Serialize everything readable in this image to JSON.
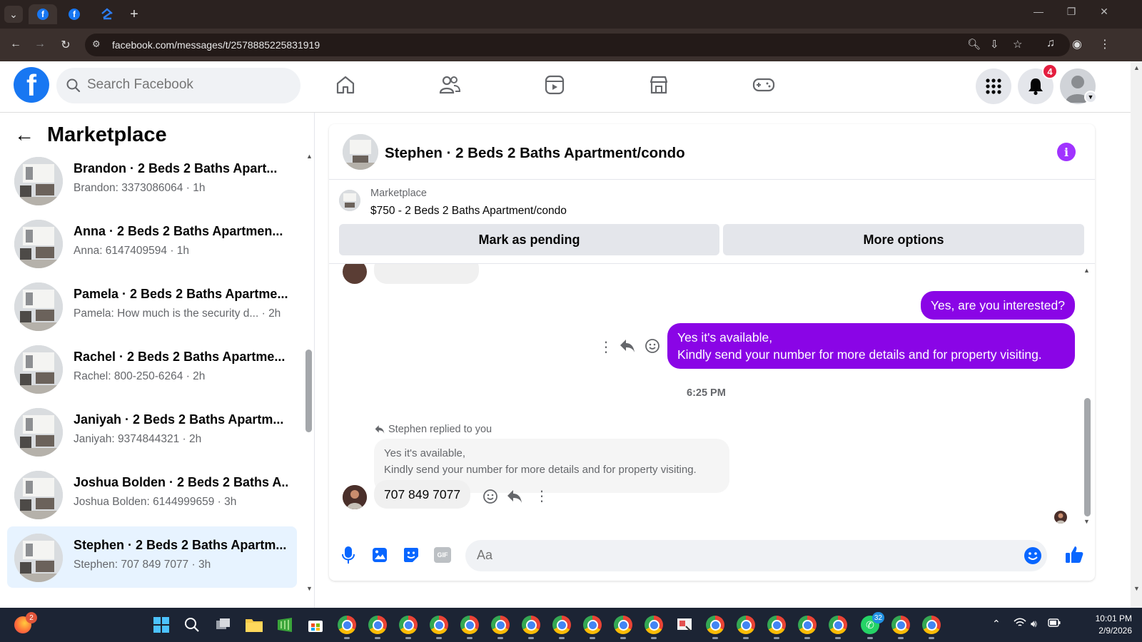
{
  "browser": {
    "url": "facebook.com/messages/t/2578885225831919",
    "new_tab": "+"
  },
  "facebook": {
    "logo_letter": "f",
    "search_placeholder": "Search Facebook",
    "notifications_count": "4"
  },
  "sidebar": {
    "title": "Marketplace",
    "conversations": [
      {
        "title": "Brandon · 2 Beds 2 Baths Apart...",
        "preview": "Brandon: 3373086064 · 1h",
        "selected": false
      },
      {
        "title": "Anna · 2 Beds 2 Baths Apartmen...",
        "preview": "Anna: 6147409594 · 1h",
        "selected": false
      },
      {
        "title": "Pamela · 2 Beds 2 Baths Apartme...",
        "preview": "Pamela: How much is the security d... · 2h",
        "selected": false
      },
      {
        "title": "Rachel · 2 Beds 2 Baths Apartme...",
        "preview": "Rachel: 800-250-6264 · 2h",
        "selected": false
      },
      {
        "title": "Janiyah · 2 Beds 2 Baths Apartm...",
        "preview": "Janiyah: 9374844321 · 2h",
        "selected": false
      },
      {
        "title": "Joshua Bolden · 2 Beds 2 Baths A...",
        "preview": "Joshua Bolden: 6144999659 · 3h",
        "selected": false
      },
      {
        "title": "Stephen · 2 Beds 2 Baths Apartm...",
        "preview": "Stephen: 707 849 7077 · 3h",
        "selected": true
      }
    ]
  },
  "chat": {
    "title": "Stephen · 2 Beds 2 Baths Apartment/condo",
    "marketplace_label": "Marketplace",
    "listing": "$750 - 2 Beds 2 Baths Apartment/condo",
    "mark_pending": "Mark as pending",
    "more_options": "More options",
    "messages": {
      "out1": "Yes, are you interested?",
      "out2_line1": "Yes it's available,",
      "out2_line2": "Kindly send your number for more details and for property visiting.",
      "timestamp": "6:25 PM",
      "replied_label": "Stephen replied to you",
      "quoted_line1": "Yes it's available,",
      "quoted_line2": "Kindly send your number for more details and for property visiting.",
      "in_reply": "707 849 7077"
    },
    "composer_placeholder": "Aa",
    "gif_label": "GIF"
  },
  "taskbar": {
    "firefox_badge": "2",
    "whatsapp_badge": "32",
    "time": "10:01 PM",
    "date": "2/9/2026"
  },
  "colors": {
    "fb_blue": "#1877f2",
    "messenger_purple": "#8a05e6",
    "selected_bg": "#e7f3ff"
  }
}
